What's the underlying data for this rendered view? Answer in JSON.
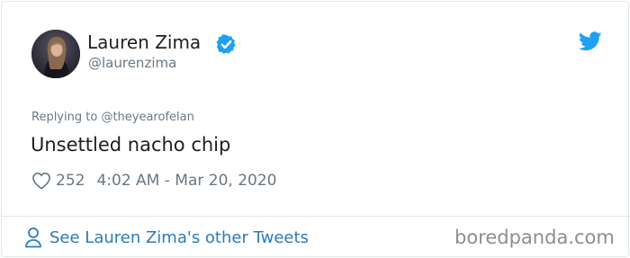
{
  "tweet": {
    "author": {
      "display_name": "Lauren Zima",
      "handle": "@laurenzima",
      "verified": true
    },
    "replying_to_prefix": "Replying to",
    "replying_to_handle": "@theyearofelan",
    "text": "Unsettled nacho chip",
    "like_count": "252",
    "timestamp": "4:02 AM - Mar 20, 2020"
  },
  "footer": {
    "other_tweets_label": "See Lauren Zima's other Tweets"
  },
  "watermark": "boredpanda.com",
  "icons": {
    "verified": "verified-badge-icon",
    "twitter": "twitter-bird-icon",
    "like": "heart-icon",
    "profile": "person-icon"
  },
  "colors": {
    "twitter_blue": "#1da1f2",
    "link_blue": "#2b7bb9",
    "text_primary": "#1c2022",
    "text_secondary": "#697882",
    "border": "#e1e8ed"
  }
}
